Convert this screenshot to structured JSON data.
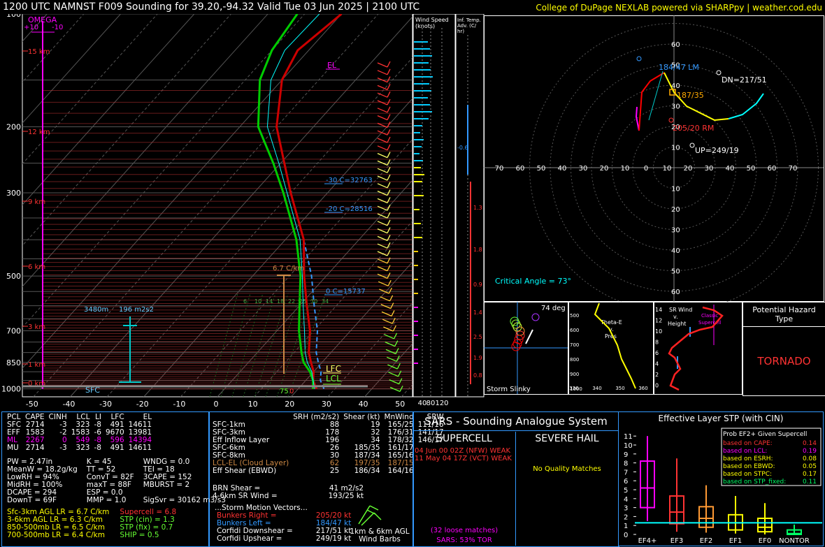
{
  "header": {
    "title": "1200 UTC NAMNST F009 Sounding for 39.20,-94.32 Valid  Tue 03 Jun 2025 | 2100 UTC",
    "credit": "College of DuPage NEXLAB powered via SHARPpy | weather.cod.edu"
  },
  "skewt": {
    "pressure_labels": [
      "100",
      "200",
      "300",
      "500",
      "700",
      "850",
      "1000"
    ],
    "temp_labels": [
      "-50",
      "-40",
      "-30",
      "-20",
      "-10",
      "0",
      "10",
      "20",
      "30",
      "40",
      "50"
    ],
    "height_labels": [
      "15 km",
      "12 km",
      "9 km",
      "6 km",
      "3 km",
      "1 km",
      "0 km"
    ],
    "omega_label": "OMEGA",
    "omega_ticks": [
      "+10",
      "-10"
    ],
    "el_label": "EL",
    "lfc_label": "LFC",
    "lcl_label": "LCL",
    "sfc_label": "SFC",
    "sfc_temp": "75",
    "sfc_dew": "0",
    "m30_label": "-30 C=32763",
    "m20_label": "-20 C=28516",
    "zero_label": "0 C=15737",
    "lapse_label": "6.7 C/km",
    "eff_inflow_label": "3480m",
    "srh_label": "196 m2s2",
    "dendritic": [
      "6",
      "10",
      "14",
      "18",
      "22",
      "25",
      "30",
      "34"
    ]
  },
  "wind_speed": {
    "title": "Wind Speed (knots)",
    "ticks": [
      "40",
      "80",
      "120"
    ]
  },
  "inf_temp": {
    "title": "Inf. Temp. Adv. (C/hr)",
    "values": [
      "-0.6",
      "1.3",
      "1.8",
      "0.9",
      "1.4",
      "2.5",
      "1.9",
      "0.8"
    ]
  },
  "hodograph": {
    "rings": [
      "10",
      "20",
      "30",
      "40",
      "50",
      "60"
    ],
    "x_labels": [
      "70",
      "60",
      "50",
      "40",
      "30",
      "20",
      "10",
      "0",
      "10",
      "20",
      "30",
      "40",
      "50",
      "60",
      "70"
    ],
    "lm_label": "184/47 LM",
    "dn_label": "DN=217/51",
    "rm_label": "205/20 RM",
    "up_label": "UP=249/19",
    "mean_label": "187/35",
    "critical": "Critical Angle = 73°"
  },
  "slinky": {
    "title": "Storm Slinky",
    "deg": "74 deg"
  },
  "theta": {
    "title": "Theta-E v. Pres",
    "ticks_y": [
      "500",
      "600",
      "700",
      "800",
      "900",
      "1000"
    ],
    "ticks_x": [
      "330",
      "340",
      "350",
      "360"
    ]
  },
  "srwind": {
    "title": "SR Wind v. Height",
    "classic": "Classic Supercell",
    "ticks": [
      "14",
      "12",
      "10",
      "8",
      "6",
      "4",
      "2",
      "0"
    ]
  },
  "hazard": {
    "title": "Potential Hazard Type",
    "value": "TORNADO"
  },
  "parcels": {
    "headers": [
      "PCL",
      "CAPE",
      "CINH",
      "LCL",
      "LI",
      "LFC",
      "EL"
    ],
    "rows": [
      [
        "SFC",
        "2714",
        "-3",
        "323",
        "-8",
        "491",
        "14611"
      ],
      [
        "EFF",
        "1583",
        "-2",
        "1583",
        "-6",
        "9670",
        "13981"
      ],
      [
        "ML",
        "2267",
        "0",
        "549",
        "-8",
        "596",
        "14394"
      ],
      [
        "MU",
        "2714",
        "-3",
        "323",
        "-8",
        "491",
        "14611"
      ]
    ]
  },
  "indices": [
    [
      "PW = 2.47in",
      "K = 45",
      "WNDG = 0.0"
    ],
    [
      "MeanW = 18.2g/kg",
      "TT = 52",
      "TEI = 18"
    ],
    [
      "LowRH = 94%",
      "ConvT = 82F",
      "3CAPE = 152"
    ],
    [
      "MidRH = 100%",
      "maxT = 88F",
      "MBURST = 2"
    ],
    [
      "DCAPE = 294",
      "ESP = 0.0",
      ""
    ],
    [
      "DownT = 69F",
      "MMP = 1.0",
      "SigSvr = 30162 m3/s3"
    ]
  ],
  "lapse": [
    [
      "Sfc-3km AGL LR = 6.7 C/km",
      "Supercell = 6.8"
    ],
    [
      "3-6km AGL LR = 6.3 C/km",
      "STP (cin) = 1.3"
    ],
    [
      "850-500mb LR = 6.5 C/km",
      "STP (fix) = 0.7"
    ],
    [
      "700-500mb LR = 6.4 C/km",
      "SHIP = 0.5"
    ]
  ],
  "kinematics": {
    "headers": [
      "SRH (m2/s2)",
      "Shear (kt)",
      "MnWind",
      "SRW"
    ],
    "rows": [
      [
        "SFC-1km",
        "88",
        "19",
        "165/25",
        "111/16"
      ],
      [
        "SFC-3km",
        "178",
        "32",
        "176/31",
        "141/17"
      ],
      [
        "Eff Inflow Layer",
        "196",
        "34",
        "178/32",
        "146/17"
      ],
      [
        "",
        "",
        "",
        "",
        ""
      ],
      [
        "SFC-6km",
        "26",
        "185/35",
        "161/17",
        ""
      ],
      [
        "SFC-8km",
        "30",
        "187/34",
        "165/16",
        ""
      ],
      [
        "LCL-EL (Cloud Layer)",
        "62",
        "197/35",
        "187/15",
        ""
      ],
      [
        "Eff Shear (EBWD)",
        "25",
        "186/34",
        "164/16",
        ""
      ]
    ],
    "brn": "BRN Shear =",
    "brn_val": "41 m2/s2",
    "w46": "4-6km SR Wind =",
    "w46_val": "193/25 kt",
    "storm_vec": "...Storm Motion Vectors...",
    "vectors": [
      [
        "Bunkers Right =",
        "205/20 kt"
      ],
      [
        "Bunkers Left =",
        "184/47 kt"
      ],
      [
        "Corfidi Downshear =",
        "217/51 kt"
      ],
      [
        "Corfidi Upshear =",
        "249/19 kt"
      ]
    ],
    "barbs_label": "1km & 6km AGL Wind Barbs"
  },
  "sars": {
    "title": "SARS - Sounding Analogue System",
    "supercell": "SUPERCELL",
    "hail": "SEVERE HAIL",
    "match1": "04 Jun 00 02Z (NFW)  WEAK",
    "match2": "11 May 04 17Z (VCT)  WEAK",
    "nomatch": "No Quality Matches",
    "loose": "(32 loose matches)",
    "tor": "SARS: 53% TOR"
  },
  "stp": {
    "title": "Effective Layer STP (with CIN)",
    "legend_title": "Prob EF2+ Given Supercell",
    "legend": [
      [
        "based on CAPE:",
        "0.14"
      ],
      [
        "based on LCL:",
        "0.19"
      ],
      [
        "based on ESRH:",
        "0.08"
      ],
      [
        "based on EBWD:",
        "0.05"
      ],
      [
        "based on STPC:",
        "0.17"
      ],
      [
        "based on STP_fixed:",
        "0.11"
      ]
    ],
    "cats": [
      "EF4+",
      "EF3",
      "EF2",
      "EF1",
      "EF0",
      "NONTOR"
    ],
    "yticks": [
      "11",
      "10",
      "9",
      "8",
      "7",
      "6",
      "5",
      "4",
      "3",
      "2",
      "1",
      "0"
    ]
  },
  "chart_data": {
    "type": "line",
    "title": "1200 UTC NAMNST F009 Sounding for 39.20,-94.32 Valid  Tue 03 Jun 2025 | 2100 UTC",
    "pressure_hPa": [
      1000,
      950,
      900,
      850,
      800,
      700,
      600,
      500,
      400,
      300,
      250,
      200,
      150,
      125,
      100
    ],
    "temperature_C": [
      25,
      22,
      20,
      17,
      14,
      9,
      2,
      -6,
      -15,
      -30,
      -39,
      -50,
      -60,
      -63,
      -60
    ],
    "dewpoint_C": [
      24,
      22,
      19,
      15,
      12,
      6,
      0,
      -7,
      -17,
      -32,
      -42,
      -55,
      -66,
      -70,
      -72
    ],
    "ylim": [
      1050,
      100
    ],
    "xlim": [
      -50,
      50
    ],
    "stp_boxes": [
      {
        "cat": "EF4+",
        "p10": 1.5,
        "p25": 3.0,
        "median": 5.2,
        "p75": 8.2,
        "p90": 11.0
      },
      {
        "cat": "EF3",
        "p10": 0.3,
        "p25": 1.2,
        "median": 2.5,
        "p75": 4.3,
        "p90": 8.5
      },
      {
        "cat": "EF2",
        "p10": 0.2,
        "p25": 0.8,
        "median": 1.8,
        "p75": 3.1,
        "p90": 5.5
      },
      {
        "cat": "EF1",
        "p10": 0.1,
        "p25": 0.5,
        "median": 1.3,
        "p75": 2.2,
        "p90": 4.3
      },
      {
        "cat": "EF0",
        "p10": 0.0,
        "p25": 0.3,
        "median": 0.8,
        "p75": 1.8,
        "p90": 3.5
      },
      {
        "cat": "NONTOR",
        "p10": 0.0,
        "p25": 0.0,
        "median": 0.1,
        "p75": 0.5,
        "p90": 1.1
      }
    ],
    "stp_value": 1.3
  },
  "colors": {
    "temp": "#cc0000",
    "dew": "#00cc00",
    "parcel": "#ffffff",
    "wetbulb": "#00ffff",
    "virt": "#3399ff",
    "accent_yellow": "#ffff00",
    "magenta": "#ff00ff"
  }
}
